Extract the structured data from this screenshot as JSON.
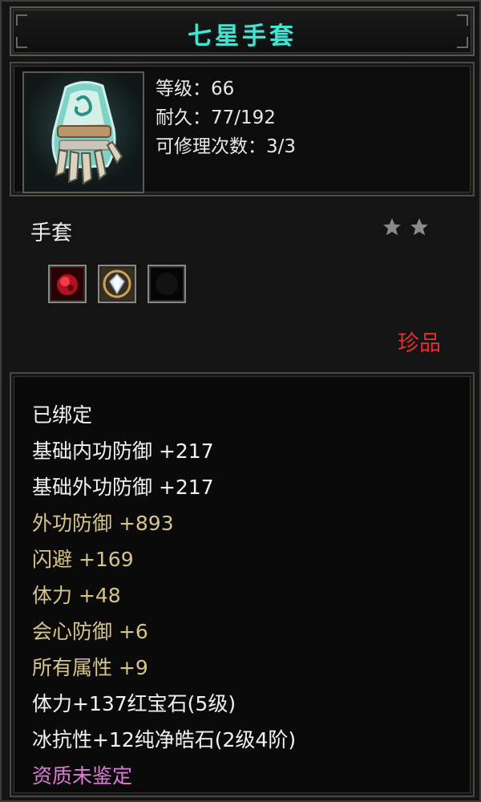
{
  "title": "七星手套",
  "item": {
    "icon": "gauntlet-icon",
    "stats": [
      "等级：66",
      "耐久：77/192",
      "可修理次数：3/3"
    ]
  },
  "type_label": "手套",
  "stars": {
    "count": 2,
    "color": "#8a8a8a"
  },
  "gem_slots": [
    {
      "name": "red-gem-icon",
      "color": "#c0182a"
    },
    {
      "name": "diamond-gem-icon",
      "color": "#dfe6ee"
    },
    {
      "name": "empty-slot-icon",
      "color": "#000000"
    }
  ],
  "rarity": "珍品",
  "attributes": [
    {
      "text": "已绑定",
      "color": "white"
    },
    {
      "text": "基础内功防御  +217",
      "color": "white"
    },
    {
      "text": "基础外功防御  +217",
      "color": "white"
    },
    {
      "text": "外功防御  +893",
      "color": "gold"
    },
    {
      "text": "闪避  +169",
      "color": "gold"
    },
    {
      "text": "体力  +48",
      "color": "gold"
    },
    {
      "text": "会心防御  +6",
      "color": "gold"
    },
    {
      "text": "所有属性  +9",
      "color": "gold"
    },
    {
      "text": "体力+137红宝石(5级)",
      "color": "white"
    },
    {
      "text": "冰抗性+12纯净皓石(2级4阶)",
      "color": "white"
    },
    {
      "text": "资质未鉴定",
      "color": "pink"
    }
  ],
  "colors": {
    "title": "#46e3d2",
    "rarity": "#e23030",
    "gold_text": "#d7c48a",
    "pink_text": "#e07ad8"
  }
}
